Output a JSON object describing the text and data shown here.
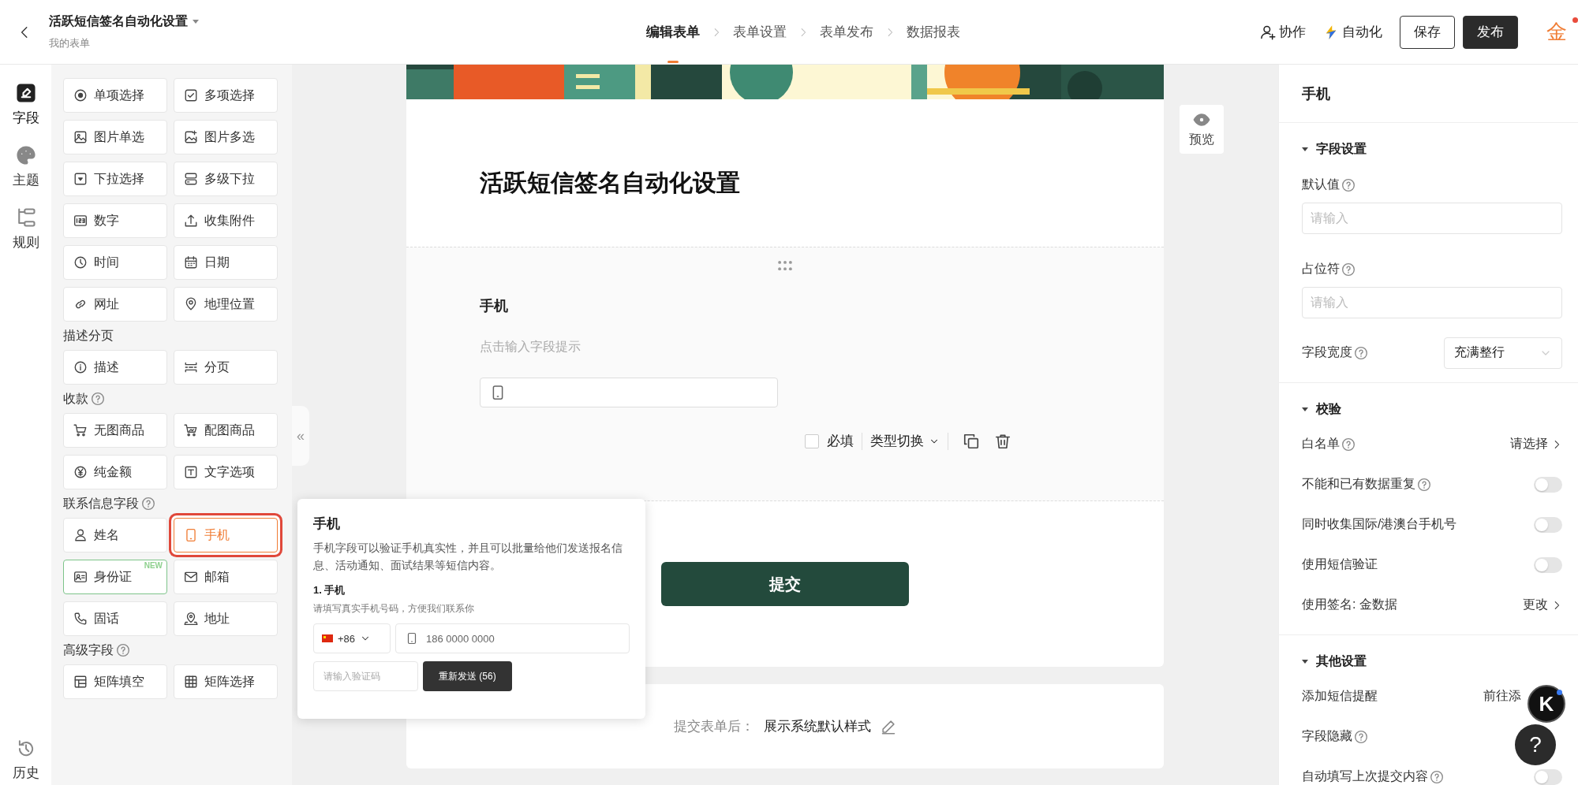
{
  "header": {
    "title": "活跃短信签名自动化设置",
    "subtitle": "我的表单",
    "steps": [
      {
        "label": "编辑表单",
        "selected": true
      },
      {
        "label": "表单设置",
        "selected": false
      },
      {
        "label": "表单发布",
        "selected": false
      },
      {
        "label": "数据报表",
        "selected": false
      }
    ],
    "actions": [
      {
        "kind": "collab",
        "label": "协作"
      },
      {
        "kind": "auto",
        "label": "自动化"
      }
    ],
    "buttons": [
      {
        "kind": "outline",
        "label": "保存"
      },
      {
        "kind": "primary",
        "label": "发布"
      }
    ],
    "logo": "金"
  },
  "rail": {
    "items": [
      {
        "label": "字段",
        "selected": true
      },
      {
        "label": "主题",
        "selected": false
      },
      {
        "label": "规则",
        "selected": false
      }
    ],
    "history": "历史"
  },
  "palette": {
    "groups": [
      {
        "items": [
          {
            "label": "单项选择",
            "selected": false
          },
          {
            "label": "多项选择",
            "selected": false
          },
          {
            "label": "图片单选",
            "selected": false
          },
          {
            "label": "图片多选",
            "selected": false
          },
          {
            "label": "下拉选择",
            "selected": false
          },
          {
            "label": "多级下拉",
            "selected": false
          },
          {
            "label": "数字",
            "selected": false
          },
          {
            "label": "收集附件",
            "selected": false
          },
          {
            "label": "时间",
            "selected": false
          },
          {
            "label": "日期",
            "selected": false
          },
          {
            "label": "网址",
            "selected": false
          },
          {
            "label": "地理位置",
            "selected": false
          }
        ]
      },
      {
        "title": "描述分页",
        "help": false,
        "items": [
          {
            "label": "描述",
            "selected": false
          },
          {
            "label": "分页",
            "selected": false
          }
        ]
      },
      {
        "title": "收款",
        "help": true,
        "items": [
          {
            "label": "无图商品",
            "selected": false
          },
          {
            "label": "配图商品",
            "selected": false
          },
          {
            "label": "纯金额",
            "selected": false
          },
          {
            "label": "文字选项",
            "selected": false
          }
        ]
      },
      {
        "title": "联系信息字段",
        "help": true,
        "items": [
          {
            "label": "姓名",
            "selected": false
          },
          {
            "label": "手机",
            "selected": true
          },
          {
            "label": "身份证",
            "selected": false,
            "badge": "NEW"
          },
          {
            "label": "邮箱",
            "selected": false
          },
          {
            "label": "固话",
            "selected": false
          },
          {
            "label": "地址",
            "selected": false
          }
        ]
      },
      {
        "title": "高级字段",
        "help": true,
        "items": [
          {
            "label": "矩阵填空",
            "selected": false
          },
          {
            "label": "矩阵选择",
            "selected": false
          }
        ]
      }
    ]
  },
  "form": {
    "title": "活跃短信签名自动化设置",
    "field": {
      "label": "手机",
      "hint": "点击输入字段提示",
      "required": false,
      "required_label": "必填",
      "type_switch": "类型切换"
    },
    "submit": "提交",
    "after_submit": {
      "label": "提交表单后：",
      "value": "展示系统默认样式"
    },
    "preview": "预览",
    "collapse": "«"
  },
  "popup": {
    "title": "手机",
    "description": "手机字段可以验证手机真实性，并且可以批量给他们发送报名信息、活动通知、面试结果等短信内容。",
    "sample_label": "1. 手机",
    "sample_hint": "请填写真实手机号码，方便我们联系你",
    "country_code": "+86",
    "phone_placeholder": "186 0000 0000",
    "code_placeholder": "请输入验证码",
    "resend": "重新发送 (56)"
  },
  "settings": {
    "title": "手机",
    "sections": [
      {
        "title": "字段设置",
        "expanded": true,
        "rows": [
          {
            "kind": "input",
            "label": "默认值",
            "help": true,
            "placeholder": "请输入"
          },
          {
            "kind": "input",
            "label": "占位符",
            "help": true,
            "placeholder": "请输入"
          },
          {
            "kind": "select",
            "label": "字段宽度",
            "help": true,
            "value": "充满整行"
          }
        ]
      },
      {
        "title": "校验",
        "expanded": true,
        "rows": [
          {
            "kind": "link",
            "label": "白名单",
            "help": true,
            "value": "请选择"
          },
          {
            "kind": "toggle",
            "label": "不能和已有数据重复",
            "help": true,
            "on": false
          },
          {
            "kind": "toggle",
            "label": "同时收集国际/港澳台手机号",
            "help": false,
            "on": false
          },
          {
            "kind": "toggle",
            "label": "使用短信验证",
            "help": false,
            "on": false
          },
          {
            "kind": "link",
            "label": "使用签名: 金数据",
            "help": false,
            "value": "更改"
          }
        ]
      },
      {
        "title": "其他设置",
        "expanded": true,
        "rows": [
          {
            "kind": "text",
            "label": "添加短信提醒",
            "help": false,
            "value": "前往添"
          },
          {
            "kind": "plain",
            "label": "字段隐藏",
            "help": true
          },
          {
            "kind": "toggle",
            "label": "自动填写上次提交内容",
            "help": true,
            "on": false
          }
        ]
      }
    ]
  },
  "floating": {
    "avatar": "K",
    "help": "?"
  }
}
